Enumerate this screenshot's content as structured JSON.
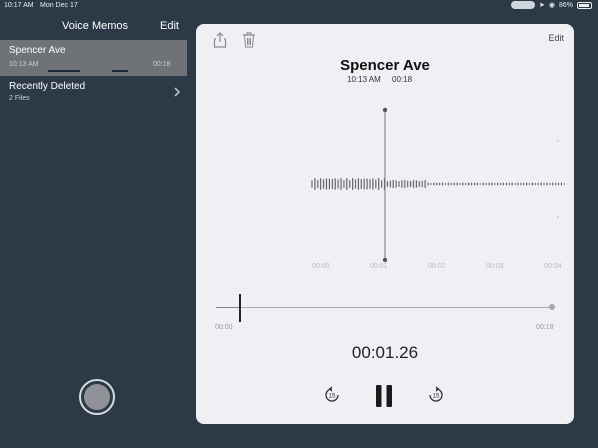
{
  "status_bar": {
    "time": "10:17 AM",
    "date": "Mon Dec 17",
    "battery": "86%"
  },
  "sidebar": {
    "title": "Voice Memos",
    "edit_label": "Edit",
    "memos": [
      {
        "name": "Spencer Ave",
        "time": "10:13 AM",
        "duration": "00:18"
      }
    ],
    "folders": [
      {
        "name": "Recently Deleted",
        "count": "2 Files"
      }
    ]
  },
  "detail": {
    "edit_label": "Edit",
    "title": "Spencer Ave",
    "time": "10:13 AM",
    "duration": "00:18",
    "timeline_labels": [
      "00:00",
      "00:01",
      "00:02",
      "00:03",
      "00:04"
    ],
    "scrub_start": "00:00",
    "scrub_end": "00:18",
    "elapsed": "00:01.26",
    "playback_fraction": 0.07
  },
  "icons": {
    "share": "share-icon",
    "trash": "trash-icon",
    "chevron": "chevron-right-icon",
    "skip_back": "skip-back-15-icon",
    "pause": "pause-icon",
    "skip_forward": "skip-forward-15-icon",
    "record": "record-icon"
  },
  "colors": {
    "background": "#2b3a46",
    "panel": "#f0eff4",
    "selected_row": "#6f7277"
  }
}
